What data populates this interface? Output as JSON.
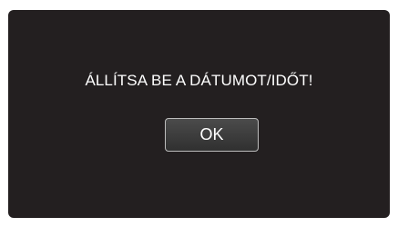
{
  "dialog": {
    "message": "ÁLLÍTSA BE A DÁTUMOT/IDŐT!",
    "ok_label": "OK"
  },
  "colors": {
    "screen_background": "#231f20",
    "text": "#ffffff",
    "button_border": "#bdbdbd"
  }
}
